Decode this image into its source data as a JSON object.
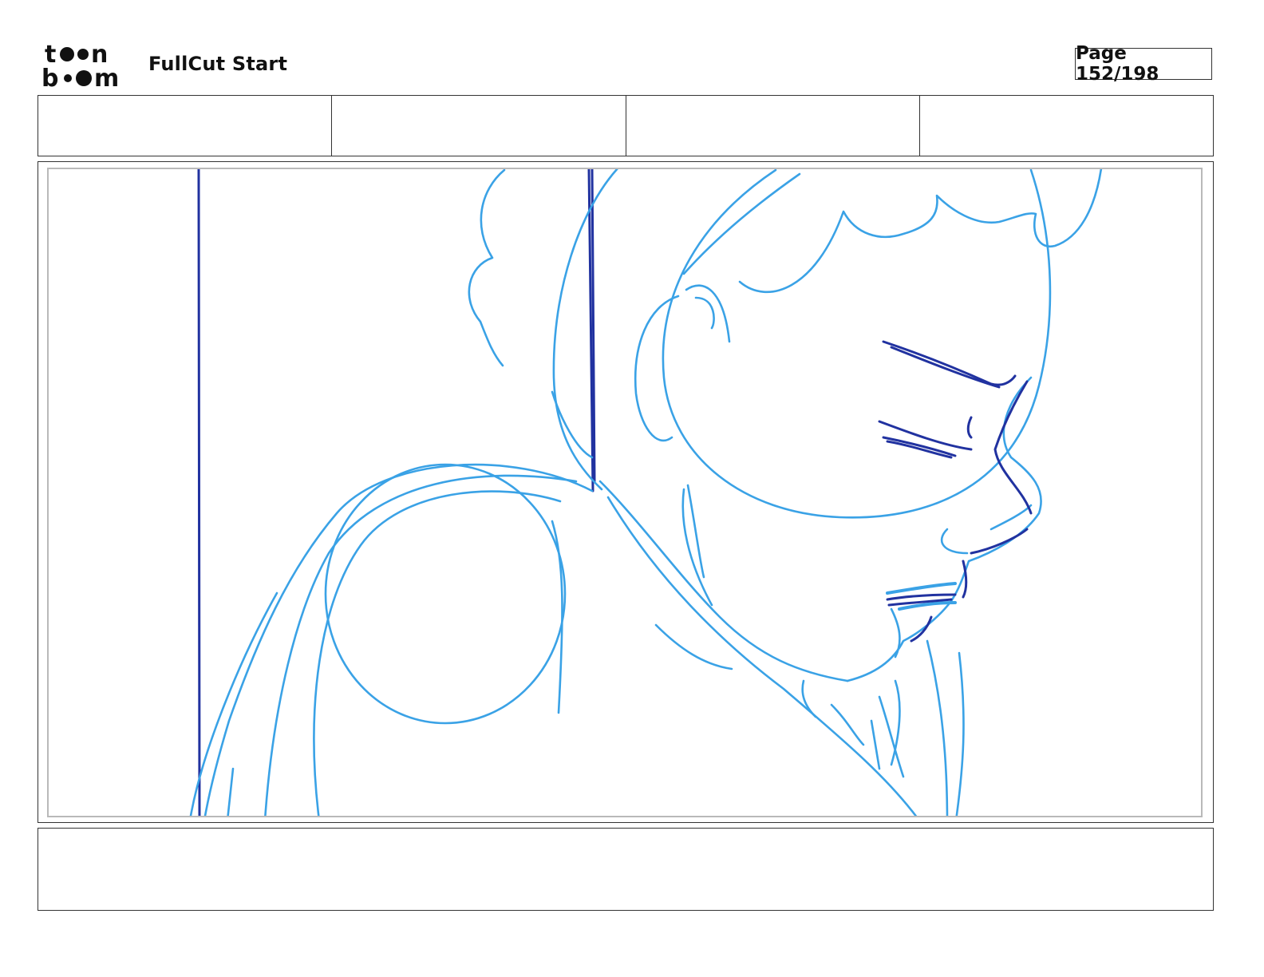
{
  "brand": {
    "logo_top": "toon",
    "logo_bottom": "boom",
    "icon": "toonboom-logo"
  },
  "header": {
    "project_title": "FullCut Start",
    "page": "Page 152/198"
  },
  "fields": [
    {
      "name": "field-1",
      "value": ""
    },
    {
      "name": "field-2",
      "value": ""
    },
    {
      "name": "field-3",
      "value": ""
    },
    {
      "name": "field-4",
      "value": ""
    }
  ],
  "panel": {
    "caption": ""
  },
  "colors": {
    "sketch_light": "#3aa2e6",
    "sketch_dark": "#2132a0",
    "border": "#333333",
    "frame": "#b9b9b9"
  }
}
